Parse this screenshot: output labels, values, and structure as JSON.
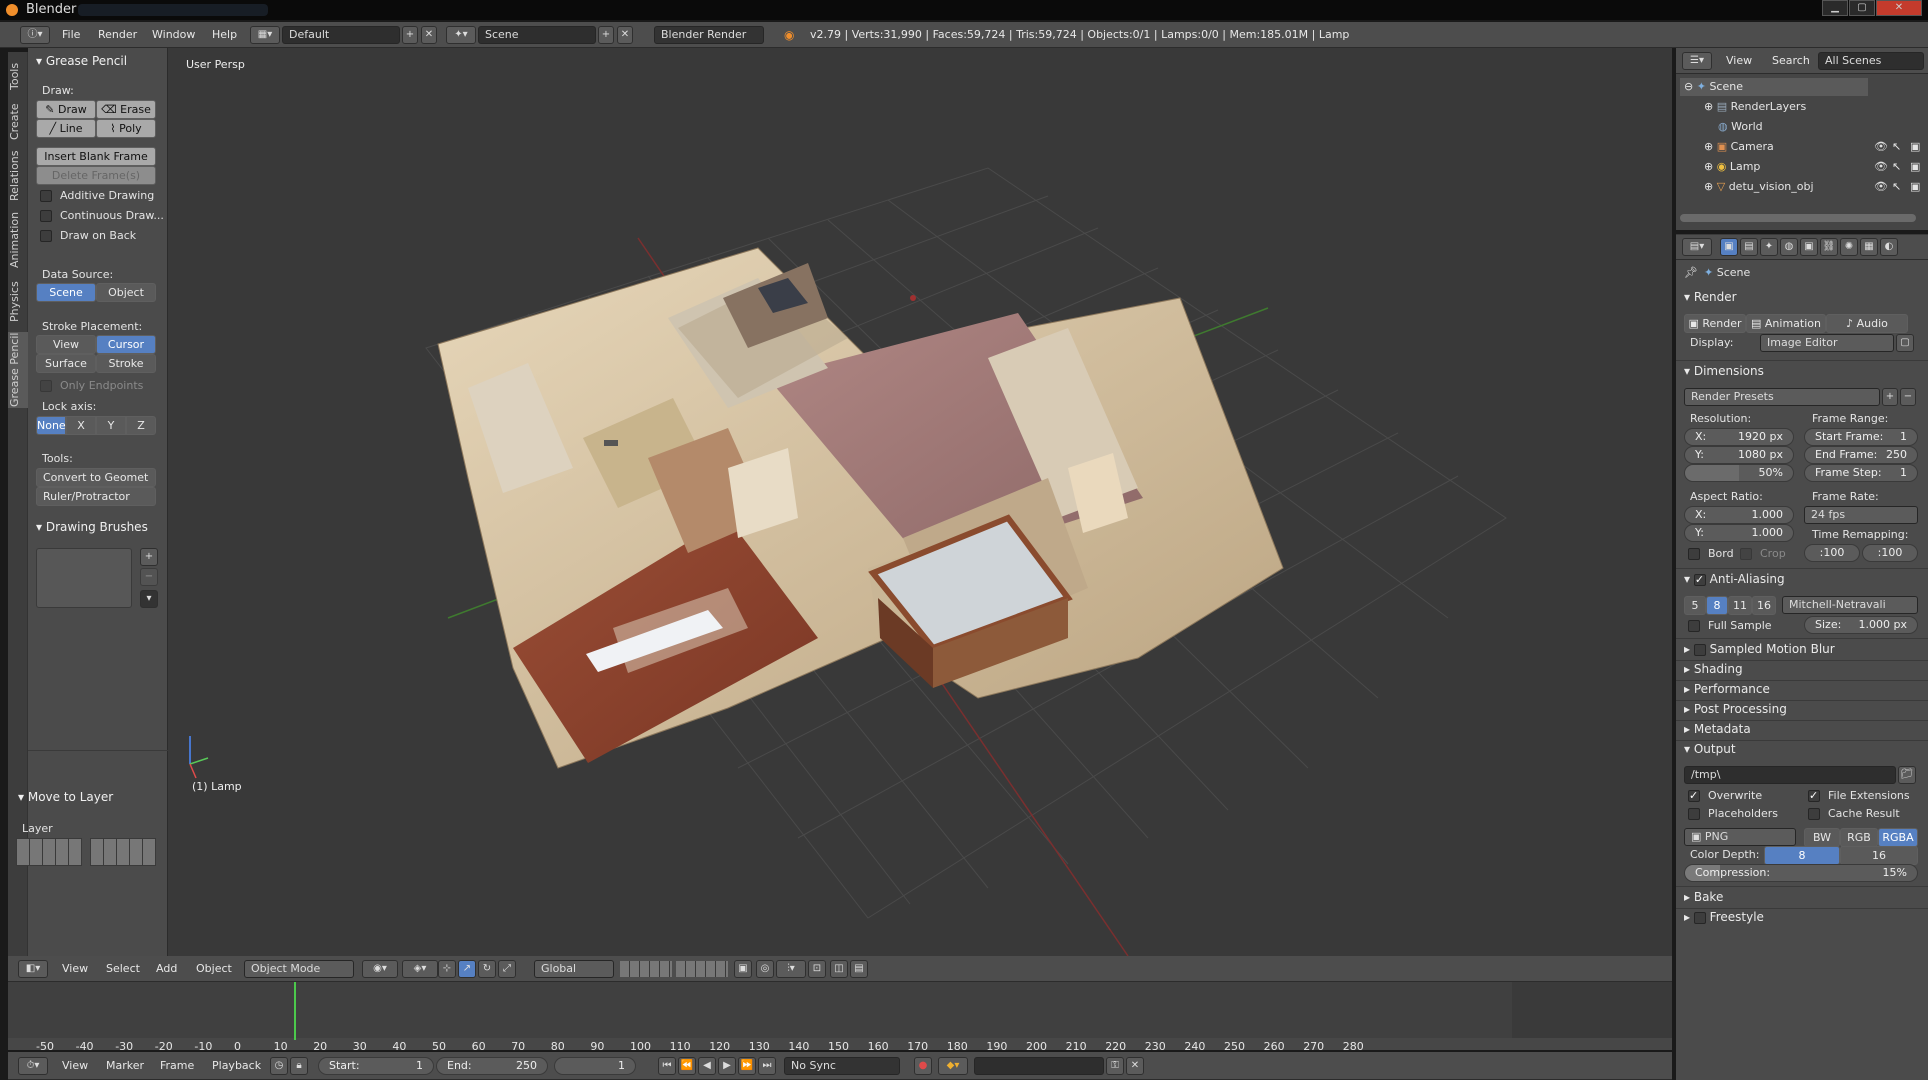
{
  "window": {
    "title": "Blender",
    "minimize": "▁",
    "maximize": "▢",
    "close": "✕"
  },
  "topbar": {
    "menus": [
      "File",
      "Render",
      "Window",
      "Help"
    ],
    "screen_layout": "Default",
    "scene": "Scene",
    "engine": "Blender Render",
    "stats": "v2.79 | Verts:31,990 | Faces:59,724 | Tris:59,724 | Objects:0/1 | Lamps:0/0 | Mem:185.01M | Lamp"
  },
  "left_tabs": [
    "Tools",
    "Create",
    "Relations",
    "Animation",
    "Physics",
    "Grease Pencil"
  ],
  "grease_pencil": {
    "title": "Grease Pencil",
    "draw_label": "Draw:",
    "draw": "Draw",
    "erase": "Erase",
    "line": "Line",
    "poly": "Poly",
    "insert_blank_frame": "Insert Blank Frame",
    "delete_frames": "Delete Frame(s)",
    "additive_drawing": "Additive Drawing",
    "continuous_draw": "Continuous Draw...",
    "draw_on_back": "Draw on Back",
    "data_source_label": "Data Source:",
    "scene_btn": "Scene",
    "object_btn": "Object",
    "stroke_placement_label": "Stroke Placement:",
    "view": "View",
    "cursor": "Cursor",
    "surface": "Surface",
    "stroke": "Stroke",
    "only_endpoints": "Only Endpoints",
    "lock_axis_label": "Lock axis:",
    "lock_none": "None",
    "lock_x": "X",
    "lock_y": "Y",
    "lock_z": "Z",
    "tools_label": "Tools:",
    "convert_to_geometry": "Convert to Geomet",
    "ruler_protractor": "Ruler/Protractor",
    "drawing_brushes": "Drawing Brushes",
    "move_to_layer": "Move to Layer",
    "layer_label": "Layer"
  },
  "viewport": {
    "perspective_label": "User Persp",
    "object_label": "(1) Lamp"
  },
  "view_header": {
    "menus": [
      "View",
      "Select",
      "Add",
      "Object"
    ],
    "mode": "Object Mode",
    "orientation": "Global"
  },
  "outliner": {
    "menus": [
      "View",
      "Search"
    ],
    "filter": "All Scenes",
    "items": [
      {
        "name": "Scene",
        "icon": "scene-icon"
      },
      {
        "name": "RenderLayers",
        "icon": "renderlayers-icon"
      },
      {
        "name": "World",
        "icon": "world-icon"
      },
      {
        "name": "Camera",
        "icon": "camera-icon"
      },
      {
        "name": "Lamp",
        "icon": "lamp-icon"
      },
      {
        "name": "detu_vision_obj",
        "icon": "mesh-icon"
      }
    ]
  },
  "properties": {
    "context": "Scene",
    "render_title": "Render",
    "render_btn": "Render",
    "animation_btn": "Animation",
    "audio_btn": "Audio",
    "display_label": "Display:",
    "display_value": "Image Editor",
    "dimensions_title": "Dimensions",
    "render_presets": "Render Presets",
    "resolution_label": "Resolution:",
    "res_x": "X:",
    "res_x_val": "1920 px",
    "res_y": "Y:",
    "res_y_val": "1080 px",
    "res_pct": "50%",
    "frame_range_label": "Frame Range:",
    "start_frame": "Start Frame:",
    "start_frame_val": "1",
    "end_frame": "End Frame:",
    "end_frame_val": "250",
    "frame_step": "Frame Step:",
    "frame_step_val": "1",
    "aspect_label": "Aspect Ratio:",
    "asp_x": "X:",
    "asp_x_val": "1.000",
    "asp_y": "Y:",
    "asp_y_val": "1.000",
    "frame_rate_label": "Frame Rate:",
    "frame_rate": "24 fps",
    "time_remap_label": "Time Remapping:",
    "remap_old": ":100",
    "remap_new": ":100",
    "bord": "Bord",
    "crop": "Crop",
    "aa_title": "Anti-Aliasing",
    "aa_5": "5",
    "aa_8": "8",
    "aa_11": "11",
    "aa_16": "16",
    "aa_filter": "Mitchell-Netravali",
    "full_sample": "Full Sample",
    "aa_size": "Size:",
    "aa_size_val": "1.000 px",
    "smb_title": "Sampled Motion Blur",
    "shading_title": "Shading",
    "performance_title": "Performance",
    "post_title": "Post Processing",
    "metadata_title": "Metadata",
    "output_title": "Output",
    "output_path": "/tmp\\",
    "overwrite": "Overwrite",
    "file_ext": "File Extensions",
    "placeholders": "Placeholders",
    "cache_result": "Cache Result",
    "format": "PNG",
    "bw": "BW",
    "rgb": "RGB",
    "rgba": "RGBA",
    "color_depth_label": "Color Depth:",
    "depth_8": "8",
    "depth_16": "16",
    "compression": "Compression:",
    "compression_val": "15%",
    "compression_fraction": 0.15,
    "bake_title": "Bake",
    "freestyle_title": "Freestyle"
  },
  "timeline": {
    "ticks": [
      -50,
      -40,
      -30,
      -20,
      -10,
      0,
      10,
      20,
      30,
      40,
      50,
      60,
      70,
      80,
      90,
      100,
      110,
      120,
      130,
      140,
      150,
      160,
      170,
      180,
      190,
      200,
      210,
      220,
      230,
      240,
      250,
      260,
      270,
      280
    ],
    "menus": [
      "View",
      "Marker",
      "Frame",
      "Playback"
    ],
    "start_label": "Start:",
    "start": "1",
    "end_label": "End:",
    "end": "250",
    "current": "1",
    "sync": "No Sync"
  }
}
